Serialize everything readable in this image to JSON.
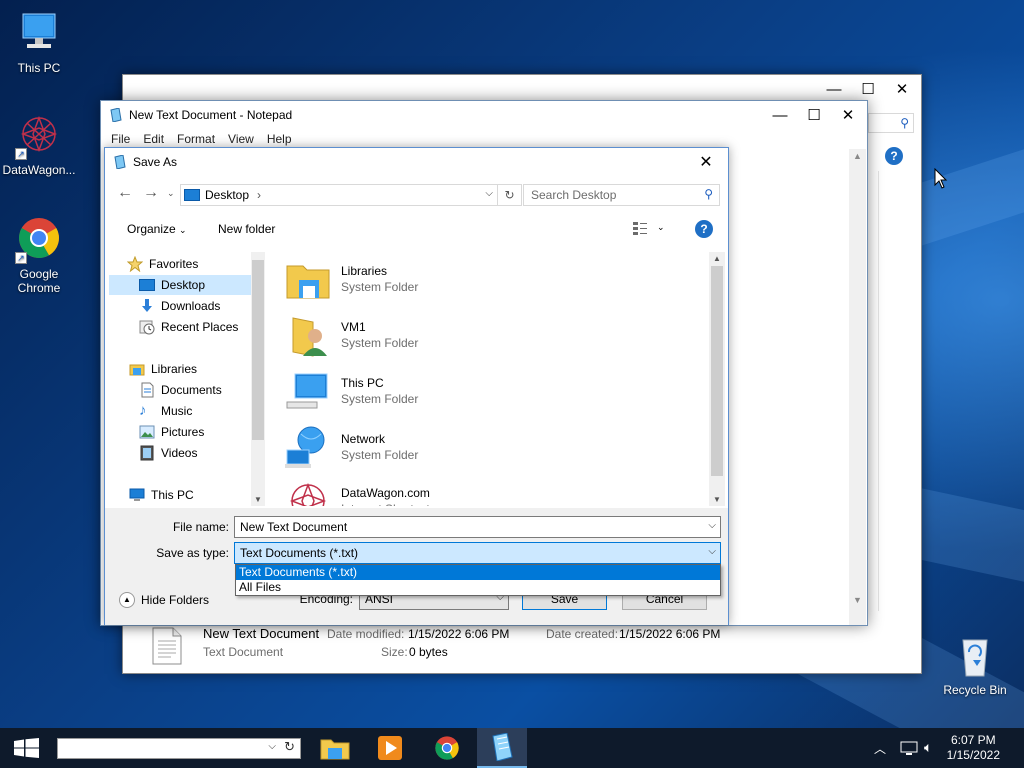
{
  "desktop": {
    "icons": [
      {
        "label": "This PC"
      },
      {
        "label": "DataWagon..."
      },
      {
        "label": "Google Chrome"
      },
      {
        "label": "Recycle Bin"
      }
    ]
  },
  "explorer": {
    "status": {
      "file_name": "New Text Document",
      "date_modified_label": "Date modified:",
      "date_modified": "1/15/2022 6:06 PM",
      "date_created_label": "Date created:",
      "date_created": "1/15/2022 6:06 PM",
      "file_type": "Text Document",
      "size_label": "Size:",
      "size": "0 bytes"
    }
  },
  "notepad": {
    "title": "New Text Document - Notepad",
    "menu": [
      "File",
      "Edit",
      "Format",
      "View",
      "Help"
    ]
  },
  "save_as": {
    "title": "Save As",
    "address": {
      "location": "Desktop"
    },
    "search_placeholder": "Search Desktop",
    "toolbar": {
      "organize": "Organize",
      "new_folder": "New folder"
    },
    "nav": [
      {
        "label": "Favorites",
        "icon": "star-icon"
      },
      {
        "label": "Desktop",
        "icon": "desktop-icon",
        "selected": true
      },
      {
        "label": "Downloads",
        "icon": "download-icon"
      },
      {
        "label": "Recent Places",
        "icon": "recent-places-icon"
      },
      {
        "label": "Libraries",
        "icon": "libraries-icon"
      },
      {
        "label": "Documents",
        "icon": "documents-icon"
      },
      {
        "label": "Music",
        "icon": "music-icon"
      },
      {
        "label": "Pictures",
        "icon": "pictures-icon"
      },
      {
        "label": "Videos",
        "icon": "videos-icon"
      },
      {
        "label": "This PC",
        "icon": "computer-icon"
      }
    ],
    "files": [
      {
        "name": "Libraries",
        "type": "System Folder"
      },
      {
        "name": "VM1",
        "type": "System Folder"
      },
      {
        "name": "This PC",
        "type": "System Folder"
      },
      {
        "name": "Network",
        "type": "System Folder"
      },
      {
        "name": "DataWagon.com",
        "type": "Internet Shortcut"
      }
    ],
    "file_name_label": "File name:",
    "file_name_value": "New Text Document",
    "save_as_type_label": "Save as type:",
    "save_as_type_value": "Text Documents (*.txt)",
    "type_options": [
      "Text Documents (*.txt)",
      "All Files"
    ],
    "encoding_label": "Encoding:",
    "encoding_value": "ANSI",
    "save_label": "Save",
    "cancel_label": "Cancel",
    "hide_folders_label": "Hide Folders"
  },
  "taskbar": {
    "time": "6:07 PM",
    "date": "1/15/2022"
  },
  "colors": {
    "accent": "#0078d7",
    "selection": "#cce8ff",
    "taskbar": "#0e1a2b"
  }
}
